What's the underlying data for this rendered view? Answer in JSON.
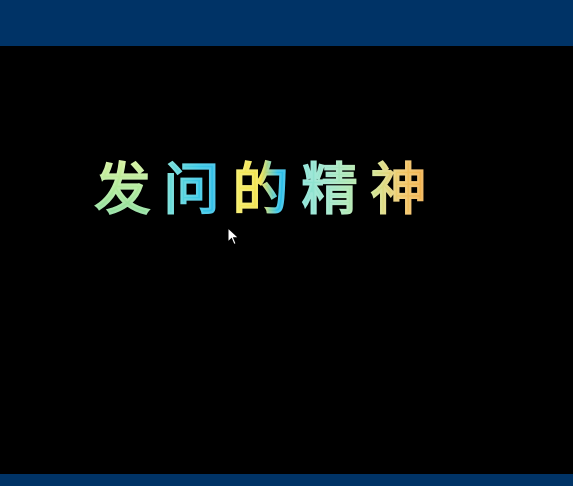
{
  "slide": {
    "title_chars": [
      "发",
      "问",
      "的",
      "精",
      "神"
    ]
  },
  "colors": {
    "frame_bar": "#003366",
    "background": "#000000"
  },
  "pointer": {
    "icon": "mouse-pointer-icon"
  }
}
